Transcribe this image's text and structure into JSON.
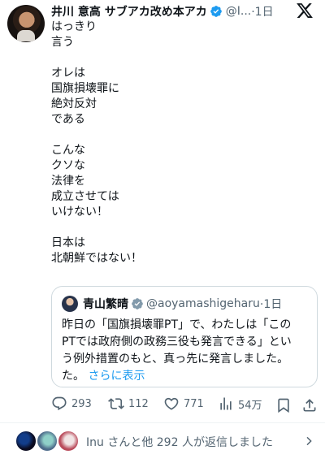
{
  "author": {
    "display_name": "井川 意高 サブアカ改め本アカ",
    "handle": "@I...",
    "time": "·1日"
  },
  "tweet_lines": [
    "はっきり",
    "言う",
    "",
    "オレは",
    "国旗損壊罪に",
    "絶対反対",
    "である",
    "",
    "こんな",
    "クソな",
    "法律を",
    "成立させては",
    "いけない！",
    "",
    "日本は",
    "北朝鮮ではない！"
  ],
  "quote": {
    "display_name": "青山繁晴",
    "handle": "@aoyamashigeharu",
    "time": "·1日",
    "lines": [
      "昨日の「国旗損壊罪PT」で、わたしは「この",
      "PTでは政府側の政務三役も発言できる」とい",
      "う例外措置のもと、真っ先に発言しました。"
    ],
    "last_line_prefix": "た。",
    "show_more": "さらに表示"
  },
  "actions": {
    "replies": "293",
    "reposts": "112",
    "likes": "771",
    "views": "54万"
  },
  "reply_summary": "Inu さんと他 292 人が返信しました",
  "colors": {
    "accent": "#1d9bf0",
    "muted": "#536471",
    "text": "#0f1419"
  },
  "icons": [
    "x-logo-icon",
    "verified-badge-icon",
    "reply-icon",
    "repost-icon",
    "like-icon",
    "views-icon",
    "bookmark-icon",
    "share-icon",
    "chevron-right-icon"
  ]
}
